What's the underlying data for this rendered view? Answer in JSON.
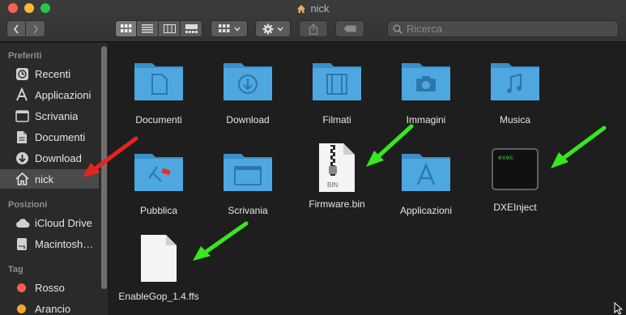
{
  "window": {
    "title": "nick"
  },
  "toolbar": {
    "back_icon": "chevron-left-icon",
    "forward_icon": "chevron-right-icon",
    "views": [
      "icon-view-icon",
      "list-view-icon",
      "column-view-icon",
      "gallery-view-icon"
    ],
    "group_icon": "group-icon",
    "action_icon": "gear-icon",
    "share_icon": "share-icon",
    "tag_icon": "tag-icon"
  },
  "search": {
    "placeholder": "Ricerca",
    "value": ""
  },
  "sidebar": {
    "sections": [
      {
        "title": "Preferiti",
        "items": [
          {
            "label": "Recenti",
            "icon": "clock-icon"
          },
          {
            "label": "Applicazioni",
            "icon": "applications-icon"
          },
          {
            "label": "Scrivania",
            "icon": "desktop-icon"
          },
          {
            "label": "Documenti",
            "icon": "document-icon"
          },
          {
            "label": "Download",
            "icon": "download-icon"
          },
          {
            "label": "nick",
            "icon": "home-icon",
            "selected": true
          }
        ]
      },
      {
        "title": "Posizioni",
        "items": [
          {
            "label": "iCloud Drive",
            "icon": "cloud-icon"
          },
          {
            "label": "Macintosh…",
            "icon": "disk-icon"
          }
        ]
      },
      {
        "title": "Tag",
        "items": [
          {
            "label": "Rosso",
            "color": "#ff5a52"
          },
          {
            "label": "Arancio",
            "color": "#f5a623"
          }
        ]
      }
    ]
  },
  "files": [
    {
      "name": "Documenti",
      "type": "folder",
      "glyph": "document"
    },
    {
      "name": "Download",
      "type": "folder",
      "glyph": "download"
    },
    {
      "name": "Filmati",
      "type": "folder",
      "glyph": "film"
    },
    {
      "name": "Immagini",
      "type": "folder",
      "glyph": "camera"
    },
    {
      "name": "Musica",
      "type": "folder",
      "glyph": "music"
    },
    {
      "name": "Pubblica",
      "type": "folder",
      "glyph": "public"
    },
    {
      "name": "Scrivania",
      "type": "folder",
      "glyph": "desktop"
    },
    {
      "name": "Firmware.bin",
      "type": "file",
      "badge": "BIN"
    },
    {
      "name": "Applicazioni",
      "type": "folder",
      "glyph": "apps"
    },
    {
      "name": "DXEInject",
      "type": "exec",
      "badge": "exec"
    },
    {
      "name": "EnableGop_1.4.ffs",
      "type": "blank"
    }
  ],
  "annotations": {
    "red_arrow_color": "#e8231f",
    "green_arrow_color": "#37e81f"
  }
}
